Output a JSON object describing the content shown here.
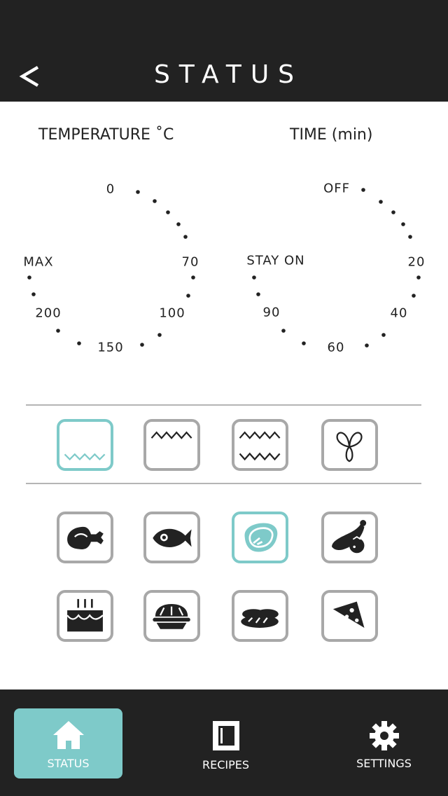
{
  "header": {
    "title": "STATUS",
    "back_icon": "chevron-left-icon"
  },
  "temperature": {
    "title": "TEMPERATURE ˚C",
    "labels": {
      "zero": "0",
      "seventy": "70",
      "hundred": "100",
      "one_fifty": "150",
      "two_hundred": "200",
      "max": "MAX"
    }
  },
  "time": {
    "title": "TIME (min)",
    "labels": {
      "off": "OFF",
      "twenty": "20",
      "forty": "40",
      "sixty": "60",
      "ninety": "90",
      "stay_on": "STAY ON"
    }
  },
  "heat_modes": [
    {
      "name": "bottom-heat",
      "icon": "bottom-heat-icon",
      "selected": true
    },
    {
      "name": "top-heat",
      "icon": "top-heat-icon",
      "selected": false
    },
    {
      "name": "top-bottom-heat",
      "icon": "top-bottom-heat-icon",
      "selected": false
    },
    {
      "name": "fan",
      "icon": "fan-icon",
      "selected": false
    }
  ],
  "food_presets": [
    {
      "name": "poultry",
      "icon": "chicken-leg-icon",
      "selected": false
    },
    {
      "name": "fish",
      "icon": "fish-icon",
      "selected": false
    },
    {
      "name": "meat",
      "icon": "steak-icon",
      "selected": true
    },
    {
      "name": "vegetables",
      "icon": "vegetables-icon",
      "selected": false
    },
    {
      "name": "cake",
      "icon": "cake-icon",
      "selected": false
    },
    {
      "name": "pie",
      "icon": "pie-icon",
      "selected": false
    },
    {
      "name": "bread",
      "icon": "bread-icon",
      "selected": false
    },
    {
      "name": "pizza",
      "icon": "pizza-icon",
      "selected": false
    }
  ],
  "nav": {
    "status_label": "STATUS",
    "recipes_label": "RECIPES",
    "settings_label": "SETTINGS",
    "active": "STATUS"
  },
  "colors": {
    "accent": "#7ecac9",
    "dark": "#222222",
    "tile_border": "#a8a8a8"
  }
}
